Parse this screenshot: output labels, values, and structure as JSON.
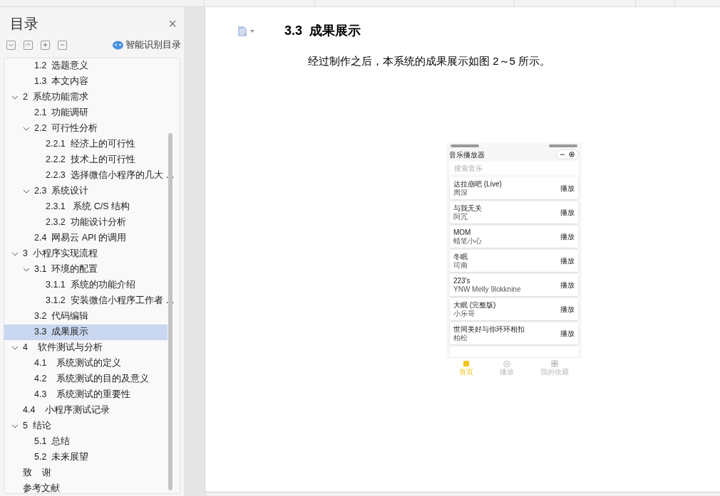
{
  "toc_panel": {
    "title": "目录",
    "close": "×",
    "toolbar": [
      {
        "kind": "expand-all"
      },
      {
        "kind": "collapse-all"
      },
      {
        "kind": "plus"
      },
      {
        "kind": "minus"
      }
    ],
    "smart_button": "智能识别目录",
    "items": [
      {
        "children": [
          {
            "label": "1.2  选题意义",
            "selected": false
          },
          {
            "label": "1.3  本文内容",
            "selected": false
          }
        ]
      },
      {
        "label": "2  系统功能需求",
        "selected": false,
        "expanded": true,
        "children": [
          {
            "label": "2.1  功能调研",
            "selected": false
          },
          {
            "label": "2.2  可行性分析",
            "selected": false,
            "expanded": true,
            "children": [
              {
                "label": "2.2.1  经济上的可行性",
                "selected": false
              },
              {
                "label": "2.2.2  技术上的可行性",
                "selected": false
              },
              {
                "label": "2.2.3  选择微信小程序的几大 …",
                "selected": false
              }
            ]
          },
          {
            "label": "2.3  系统设计",
            "selected": false,
            "expanded": true,
            "children": [
              {
                "label": "2.3.1   系统 C/S 结构",
                "selected": false
              },
              {
                "label": "2.3.2  功能设计分析",
                "selected": false
              }
            ]
          },
          {
            "label": "2.4  网易云 API 的调用",
            "selected": false
          }
        ]
      },
      {
        "label": "3  小程序实现流程",
        "selected": false,
        "expanded": true,
        "children": [
          {
            "label": "3.1  环境的配置",
            "selected": false,
            "expanded": true,
            "children": [
              {
                "label": "3.1.1  系统的功能介绍",
                "selected": false
              },
              {
                "label": "3.1.2  安装微信小程序工作者 …",
                "selected": false
              }
            ]
          },
          {
            "label": "3.2  代码编辑",
            "selected": false
          },
          {
            "label": "3.3  成果展示",
            "selected": true
          }
        ]
      },
      {
        "label": "4    软件测试与分析",
        "selected": false,
        "expanded": true,
        "children": [
          {
            "label": "4.1    系统测试的定义",
            "selected": false
          },
          {
            "label": "4.2    系统测试的目的及意义",
            "selected": false
          },
          {
            "label": "4.3    系统测试的重要性",
            "selected": false
          }
        ]
      },
      {
        "label": "4.4    小程序测试记录",
        "selected": false
      },
      {
        "label": "5  结论",
        "selected": false,
        "expanded": true,
        "children": [
          {
            "label": "5.1  总结",
            "selected": false
          },
          {
            "label": "5.2  未来展望",
            "selected": false
          }
        ]
      },
      {
        "label": "致    谢",
        "selected": false
      },
      {
        "label": "参考文献",
        "selected": false
      }
    ]
  },
  "document": {
    "heading_number": "3.3",
    "heading": "成果展示",
    "paragraph": "经过制作之后，本系统的成果展示如图 2～5 所示。",
    "phone": {
      "app_title": "音乐播放器",
      "menu_dots": "•••",
      "search_placeholder": "搜索音乐",
      "songs": [
        {
          "title": "达拉崩吧 (Live)",
          "artist": "周深",
          "action": "播放"
        },
        {
          "title": "与我无关",
          "artist": "阿冗",
          "action": "播放"
        },
        {
          "title": "MOM",
          "artist": "蜡笔小心",
          "action": "播放"
        },
        {
          "title": "冬眠",
          "artist": "司南",
          "action": "播放"
        },
        {
          "title": "223's",
          "artist": "YNW Melly 9lokknine",
          "action": "播放"
        },
        {
          "title": "大眠 (完整版)",
          "artist": "小乐哥",
          "action": "播放"
        },
        {
          "title": "世间美好与你环环相扣",
          "artist": "柏松",
          "action": "播放"
        }
      ],
      "tabs": [
        {
          "label": "首页",
          "selected": true,
          "kind": "home"
        },
        {
          "label": "播放",
          "selected": false,
          "kind": "play"
        },
        {
          "label": "我的收藏",
          "selected": false,
          "kind": "grid"
        }
      ]
    }
  }
}
